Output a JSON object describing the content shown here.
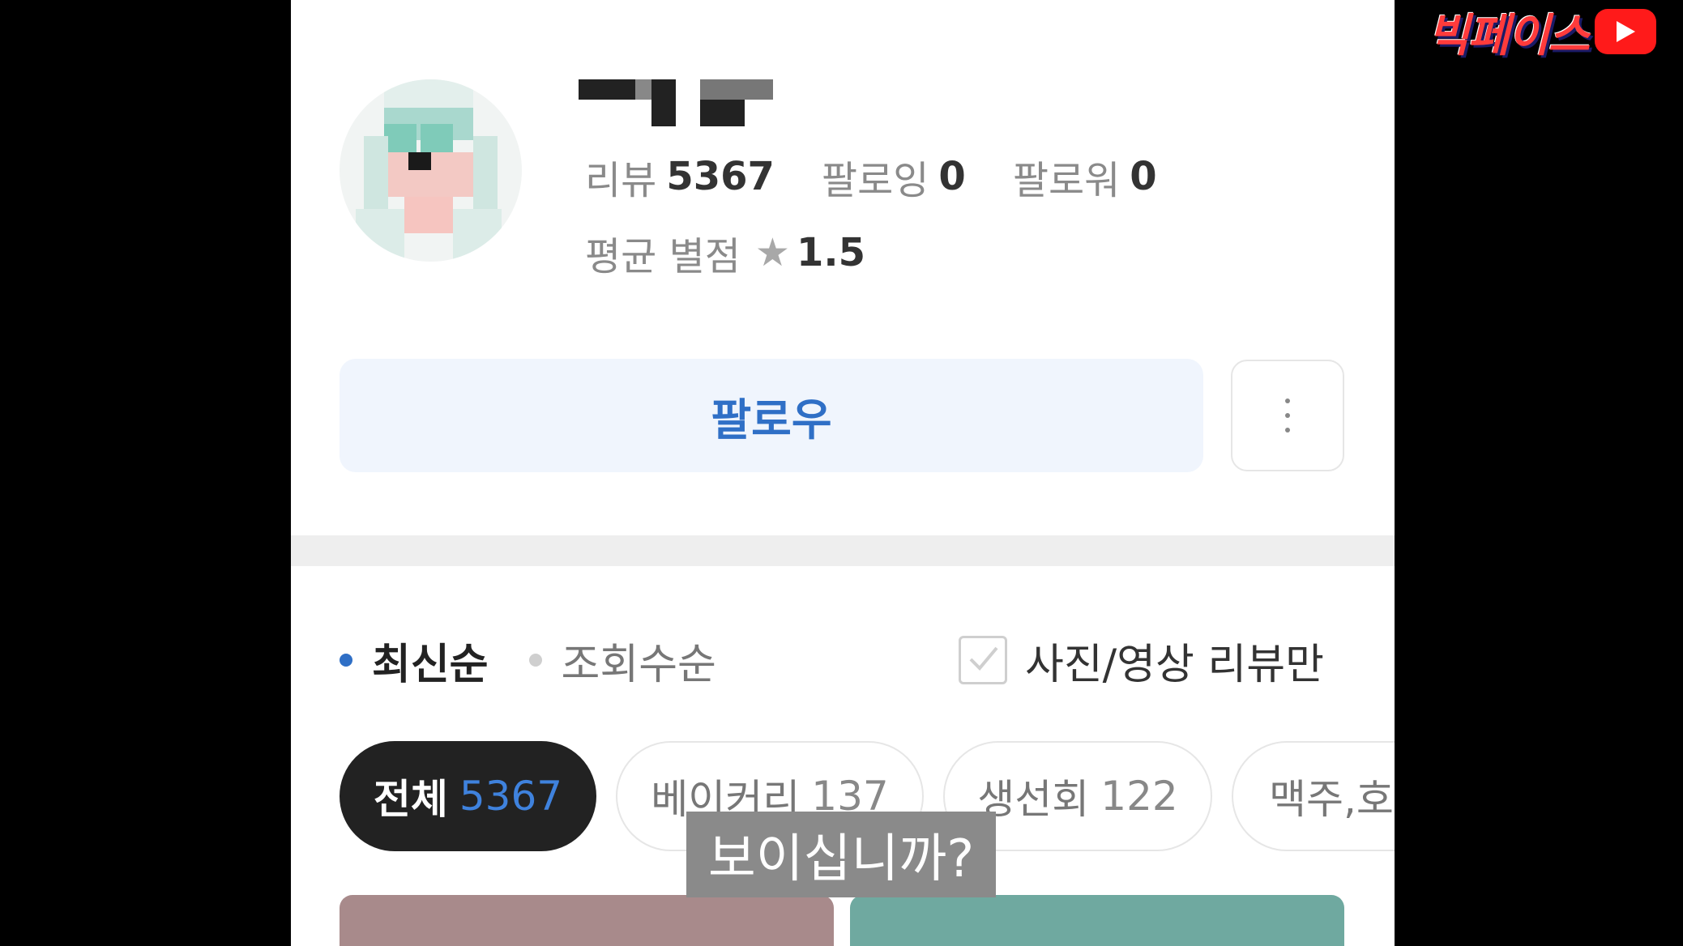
{
  "profile": {
    "stats": [
      {
        "label": "리뷰",
        "value": "5367"
      },
      {
        "label": "팔로잉",
        "value": "0"
      },
      {
        "label": "팔로워",
        "value": "0"
      }
    ],
    "rating_label": "평균 별점",
    "rating_value": "1.5",
    "follow_label": "팔로우"
  },
  "sort": {
    "options": [
      {
        "label": "최신순"
      },
      {
        "label": "조회수순"
      }
    ],
    "photo_filter_label": "사진/영상 리뷰만"
  },
  "chips": [
    {
      "label": "전체",
      "count": "5367"
    },
    {
      "label": "베이커리",
      "count": "137"
    },
    {
      "label": "생선회",
      "count": "122"
    },
    {
      "label": "맥주,호",
      "count": ""
    }
  ],
  "subtitle": "보이십니까?",
  "channel_logo": "빅페이스",
  "colors": {
    "accent": "#2f6fc6",
    "follow_bg": "#f0f5fd",
    "active_chip_bg": "#222222",
    "youtube_red": "#ff1a1a"
  },
  "icons": {
    "rating": "star-icon",
    "more": "more-vertical-icon",
    "checkbox": "checkbox-icon",
    "youtube": "youtube-play-icon"
  }
}
